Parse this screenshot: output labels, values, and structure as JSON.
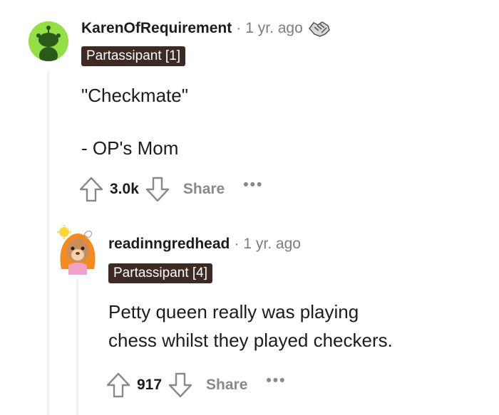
{
  "comments": [
    {
      "username": "KarenOfRequirement",
      "separator": "·",
      "time": "1 yr. ago",
      "flair": "Partassipant [1]",
      "body": [
        "\"Checkmate\"",
        "- OP's Mom"
      ],
      "score": "3.0k",
      "share_label": "Share",
      "more_label": "•••",
      "award_icon": "handshake-award-icon"
    },
    {
      "username": "readinngredhead",
      "separator": "·",
      "time": "1 yr. ago",
      "flair": "Partassipant [4]",
      "body": [
        "Petty queen really was playing",
        "chess whilst they played checkers."
      ],
      "score": "917",
      "share_label": "Share",
      "more_label": "•••"
    }
  ],
  "colors": {
    "avatar_green": "#94e044",
    "flair_bg": "#3d2a22",
    "muted": "#878a8c",
    "thread_line": "#edeff1"
  }
}
